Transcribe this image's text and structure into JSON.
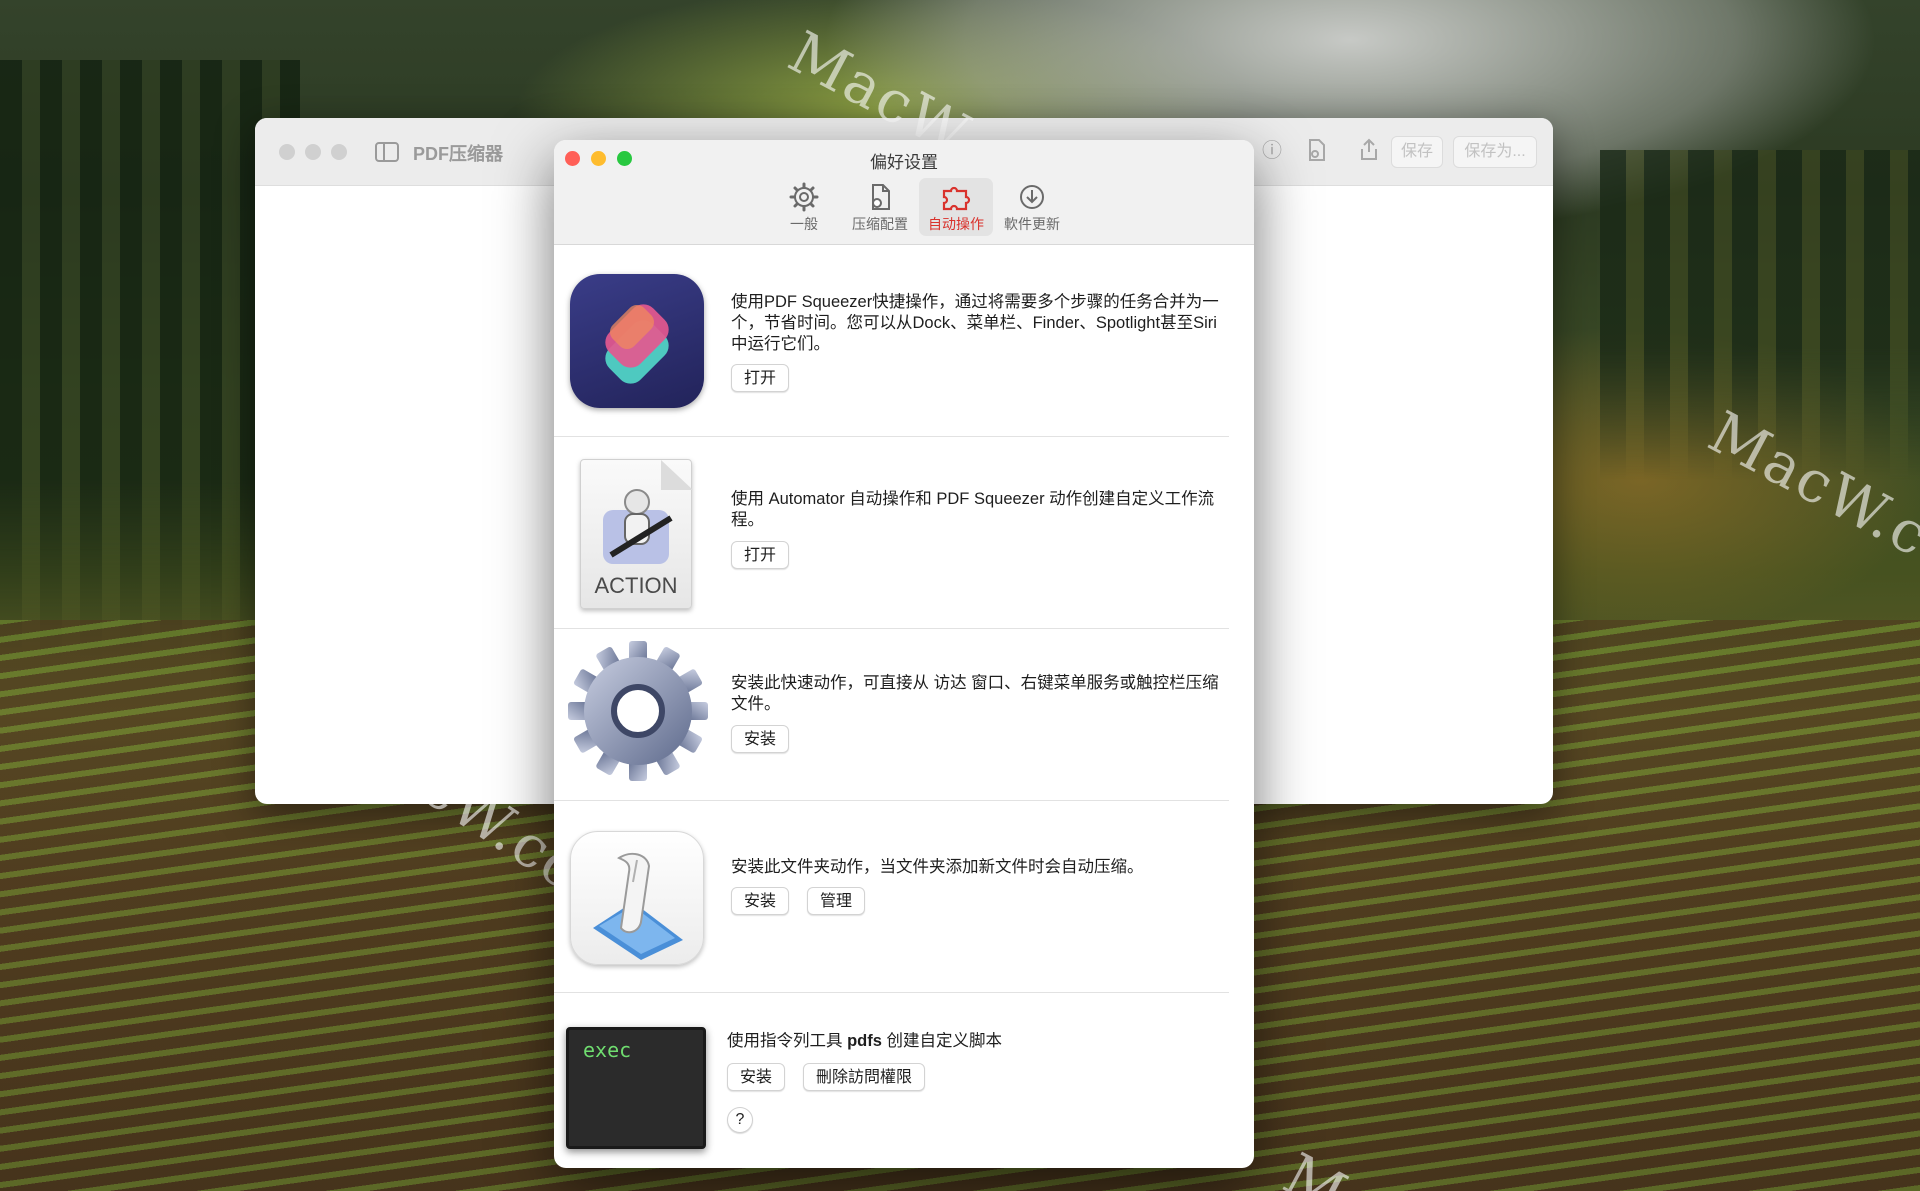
{
  "main_window": {
    "title": "PDF压缩器",
    "save_label": "保存",
    "save_as_label": "保存为..."
  },
  "prefs": {
    "title": "偏好设置",
    "tabs": [
      {
        "label": "一般",
        "icon": "gear-icon"
      },
      {
        "label": "压缩配置",
        "icon": "document-gear-icon"
      },
      {
        "label": "自动操作",
        "icon": "puzzle-icon",
        "active": true
      },
      {
        "label": "軟件更新",
        "icon": "download-circle-icon"
      }
    ],
    "sections": {
      "shortcuts": {
        "text": "使用PDF Squeezer快捷操作，通过将需要多个步骤的任务合并为一个，节省时间。您可以从Dock、菜单栏、Finder、Spotlight甚至Siri中运行它们。",
        "button": "打开"
      },
      "automator": {
        "text": "使用 Automator 自动操作和 PDF Squeezer 动作创建自定义工作流程。",
        "icon_label": "ACTION",
        "button": "打开"
      },
      "quick_action": {
        "text": "安装此快速动作，可直接从 访达 窗口、右键菜单服务或触控栏压缩文件。",
        "button": "安装"
      },
      "folder_action": {
        "text": "安装此文件夹动作，当文件夹添加新文件时会自动压缩。",
        "install_button": "安装",
        "manage_button": "管理"
      },
      "cli": {
        "text_prefix": "使用指令列工具 ",
        "text_bold": "pdfs",
        "text_suffix": " 创建自定义脚本",
        "terminal_text": "exec",
        "install_button": "安装",
        "remove_button": "刪除訪問權限",
        "help_button": "?"
      }
    }
  },
  "watermarks": [
    "MacW.com",
    "MacW.c",
    "MacW.com",
    "M"
  ],
  "colors": {
    "close": "#ff5f57",
    "minimize": "#febc2e",
    "zoom": "#28c840",
    "active_tab": "#d9322c"
  }
}
